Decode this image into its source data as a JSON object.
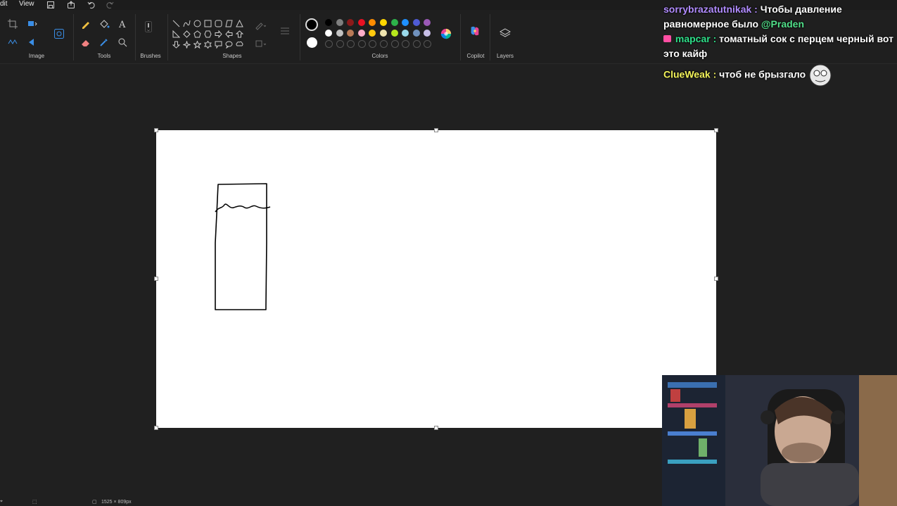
{
  "menubar": {
    "edit_partial": "dit",
    "view": "View",
    "icons": [
      "save-icon",
      "share-icon",
      "undo-icon",
      "redo-icon"
    ]
  },
  "ribbon": {
    "groups": {
      "image": "Image",
      "tools": "Tools",
      "brushes": "Brushes",
      "shapes": "Shapes",
      "colors": "Colors",
      "copilot": "Copilot",
      "layers": "Layers"
    },
    "palette_row1": [
      "#000000",
      "#7f7f7f",
      "#8b1a1a",
      "#e81123",
      "#ff8c00",
      "#ffd700",
      "#2db34a",
      "#1e90ff",
      "#4f5bd5",
      "#9b59b6"
    ],
    "palette_row2": [
      "#ffffff",
      "#c3c3c3",
      "#b97a57",
      "#ffaec9",
      "#ffc90e",
      "#efe4b0",
      "#b5e61d",
      "#99d9ea",
      "#7092be",
      "#c8bfe7"
    ],
    "primary_color": "#000000",
    "secondary_color": "#ffffff"
  },
  "status": {
    "canvas_size": "1525 × 809px"
  },
  "chat": [
    {
      "user": "sorrybrazatutnikak",
      "sep": ":",
      "text": "Чтобы давление равномерное было",
      "mention": "@Praden"
    },
    {
      "user": "mapcar",
      "sep": ":",
      "text": "томатный сок с перцем черный вот это кайф"
    },
    {
      "user": "ClueWeak",
      "sep": ":",
      "text": "чтоб не брызгало"
    }
  ],
  "webcam": {
    "label": "streamer-webcam"
  }
}
